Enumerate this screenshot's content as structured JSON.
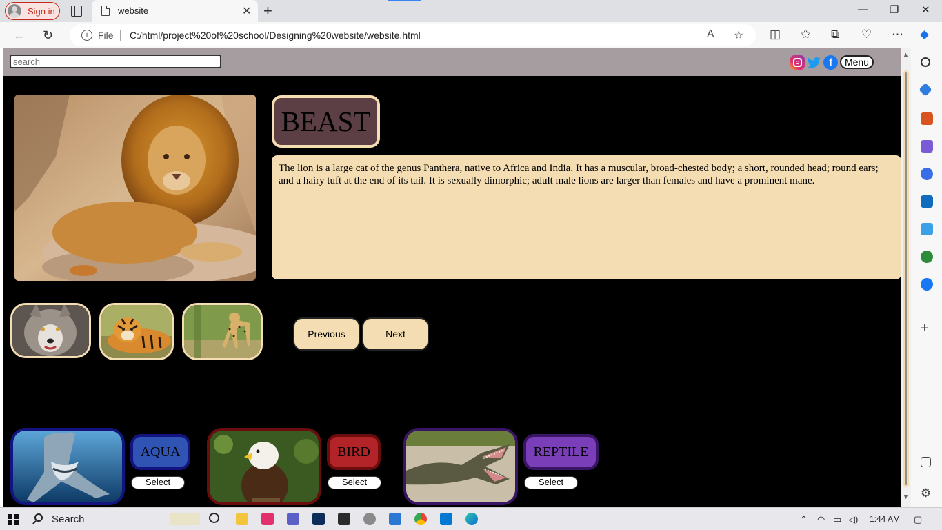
{
  "browser": {
    "signin_label": "Sign in",
    "tab_title": "website",
    "address": {
      "protocol_label": "File",
      "url": "C:/html/project%20of%20school/Designing%20website/website.html"
    }
  },
  "site": {
    "search_placeholder": "search",
    "menu_label": "Menu",
    "social_icons": [
      "instagram-icon",
      "twitter-icon",
      "facebook-icon"
    ],
    "facebook_glyph": "f",
    "featured": {
      "title": "BEAST",
      "description": "The lion is a large cat of the genus Panthera, native to Africa and India. It has a muscular, broad-chested body; a short, rounded head; round ears; and a hairy tuft at the end of its tail. It is sexually dimorphic; adult male lions are larger than females and have a prominent mane."
    },
    "thumbnails": [
      "wolf",
      "tiger",
      "cheetah"
    ],
    "nav": {
      "previous_label": "Previous",
      "next_label": "Next"
    },
    "categories": [
      {
        "label": "AQUA",
        "select_label": "Select",
        "image": "shark",
        "color": "#2f54b3",
        "border": "#141480"
      },
      {
        "label": "BIRD",
        "select_label": "Select",
        "image": "eagle",
        "color": "#b22428",
        "border": "#6b0d0f"
      },
      {
        "label": "REPTILE",
        "select_label": "Select",
        "image": "crocodile",
        "color": "#7a3fb8",
        "border": "#3a1566"
      }
    ]
  },
  "taskbar": {
    "search_label": "Search",
    "time": "1:44 AM"
  },
  "colors": {
    "header_bg": "#a59d9f",
    "page_bg": "#000000",
    "beige": "#f4ddb2",
    "title_bg": "#5b3f45"
  }
}
